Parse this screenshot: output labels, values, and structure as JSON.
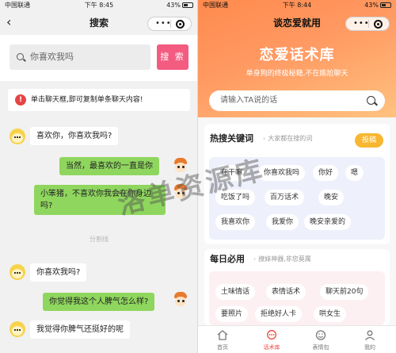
{
  "left": {
    "status": {
      "carrier": "中国联通",
      "time": "下午 8:45",
      "battery": "43%"
    },
    "nav": {
      "back": "‹",
      "title": "搜索"
    },
    "search": {
      "placeholder": "你喜欢我吗",
      "button": "搜 索"
    },
    "tip": {
      "icon": "!",
      "text": "单击聊天框,即可复制单条聊天内容!"
    },
    "messages": [
      {
        "side": "left",
        "text": "喜欢你，你喜欢我吗?"
      },
      {
        "side": "right",
        "text": "当然，最喜欢的一直是你"
      },
      {
        "side": "right",
        "text": "小笨猪，不喜欢你我会在你身边吗?"
      },
      {
        "side": "left",
        "text": "你喜欢我吗?"
      },
      {
        "side": "right",
        "text": "你觉得我这个人脾气怎么样?"
      },
      {
        "side": "left",
        "text": "我觉得你脾气还挺好的呢"
      }
    ],
    "divider": "分割线"
  },
  "right": {
    "status": {
      "carrier": "中国联通",
      "time": "下午 8:44",
      "battery": "43%"
    },
    "nav": {
      "title": "谈恋爱就用"
    },
    "hero": {
      "title": "恋爱话术库",
      "subtitle": "单身狗的终极秘籍,不在尴尬聊天"
    },
    "search": {
      "placeholder": "请输入TA说的话"
    },
    "hot": {
      "title": "热搜关键词",
      "subtitle": "大家都在搜的词",
      "button": "投稿",
      "chips": [
        "在干嘛",
        "你喜欢我吗",
        "你好",
        "嗯",
        "吃饭了吗",
        "百万话术",
        "晚安",
        "我喜欢你",
        "我爱你",
        "晚安亲爱的"
      ]
    },
    "daily": {
      "title": "每日必用",
      "subtitle": "撩妹神器,非您莫属",
      "chips": [
        "土味情话",
        "表情话术",
        "聊天前20句",
        "要照片",
        "拒绝好人卡",
        "哄女生"
      ]
    },
    "tabs": [
      {
        "label": "首页",
        "icon": "home-icon"
      },
      {
        "label": "话术库",
        "icon": "chat-icon"
      },
      {
        "label": "表情包",
        "icon": "emoji-icon"
      },
      {
        "label": "我的",
        "icon": "user-icon"
      }
    ],
    "watermark": "洛单资源库"
  },
  "colors": {
    "accent_pink": "#f45b80",
    "bubble_green": "#8fd65e",
    "hero_orange": "#ff8a4d",
    "tag_yellow": "#f7b731",
    "active_red": "#f0473c"
  }
}
